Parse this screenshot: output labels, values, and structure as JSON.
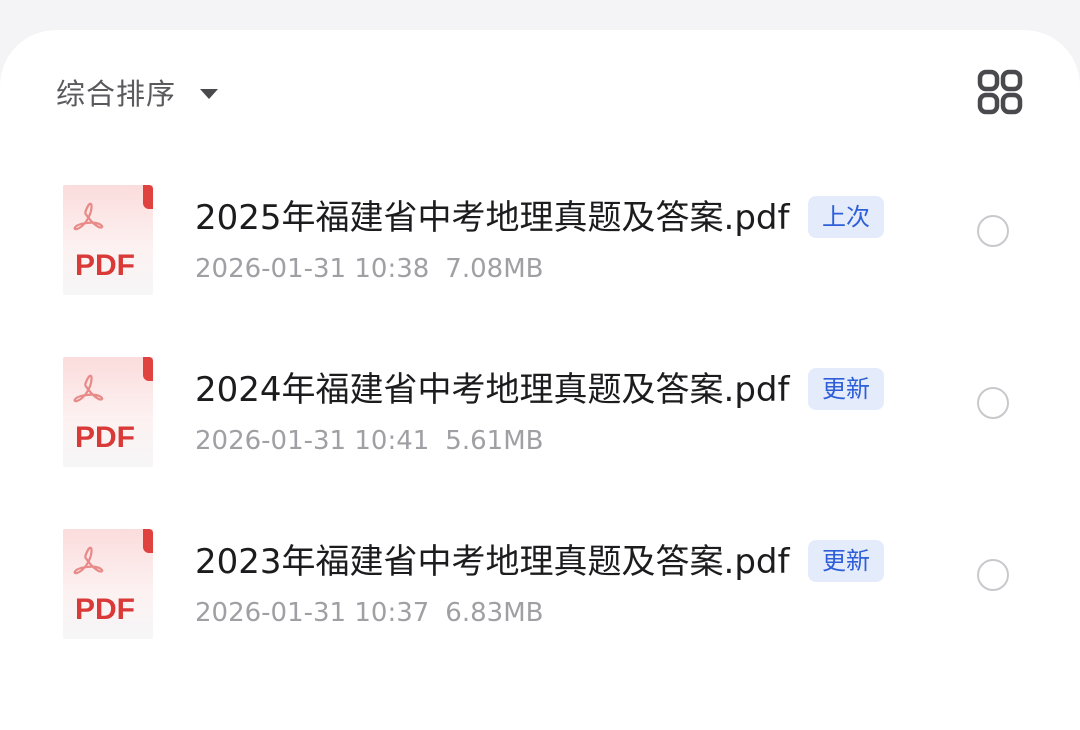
{
  "toolbar": {
    "sort_label": "综合排序",
    "sort_caret_icon": "caret-down-icon",
    "view_toggle_icon": "grid-view-icon"
  },
  "colors": {
    "pdf_red": "#d93a37",
    "tag_bg": "#e4ebfb",
    "tag_text": "#2e5fd8",
    "meta_text": "#a0a0a4"
  },
  "files": [
    {
      "name": "2025年福建省中考地理真题及答案.pdf",
      "tag": "上次",
      "date": "2026-01-31 10:38",
      "size": "7.08MB",
      "icon": "pdf-file-icon",
      "icon_label": "PDF"
    },
    {
      "name": "2024年福建省中考地理真题及答案.pdf",
      "tag": "更新",
      "date": "2026-01-31 10:41",
      "size": "5.61MB",
      "icon": "pdf-file-icon",
      "icon_label": "PDF"
    },
    {
      "name": "2023年福建省中考地理真题及答案.pdf",
      "tag": "更新",
      "date": "2026-01-31 10:37",
      "size": "6.83MB",
      "icon": "pdf-file-icon",
      "icon_label": "PDF"
    }
  ]
}
